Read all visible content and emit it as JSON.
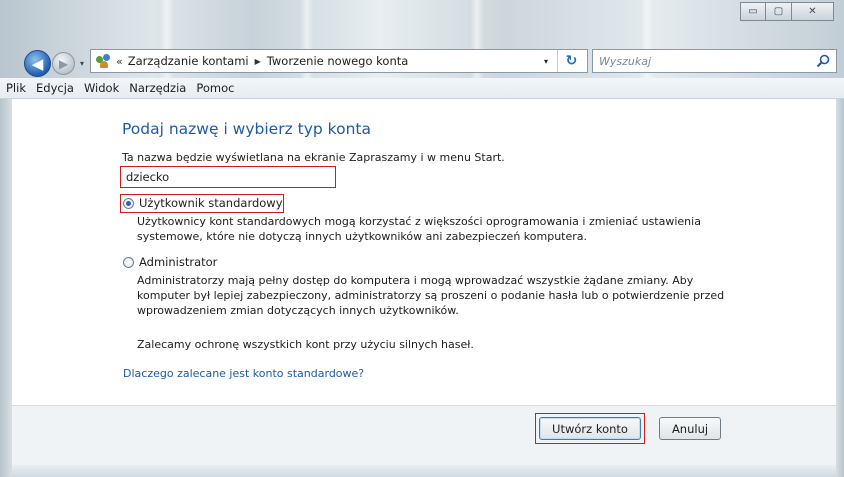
{
  "window": {
    "caption_buttons": {
      "minimize": "▭",
      "maximize": "▢",
      "close": "✕"
    }
  },
  "address_bar": {
    "chevrons": "«",
    "crumbs": [
      "Zarządzanie kontami",
      "Tworzenie nowego konta"
    ],
    "separator": "▶",
    "dropdown_glyph": "▾",
    "refresh_glyph": "↻",
    "icon": "users-icon"
  },
  "search": {
    "placeholder": "Wyszukaj",
    "icon": "search-icon"
  },
  "nav": {
    "back_glyph": "◀",
    "forward_glyph": "▶",
    "dropdown_glyph": "▾"
  },
  "menu": {
    "items": [
      "Plik",
      "Edycja",
      "Widok",
      "Narzędzia",
      "Pomoc"
    ]
  },
  "form": {
    "heading": "Podaj nazwę i wybierz typ konta",
    "name_hint": "Ta nazwa będzie wyświetlana na ekranie Zapraszamy i w menu Start.",
    "name_value": "dziecko",
    "options": [
      {
        "label": "Użytkownik standardowy",
        "checked": true,
        "description": "Użytkownicy kont standardowych mogą korzystać z większości oprogramowania i zmieniać ustawienia systemowe, które nie dotyczą innych użytkowników ani zabezpieczeń komputera."
      },
      {
        "label": "Administrator",
        "checked": false,
        "description": "Administratorzy mają pełny dostęp do komputera i mogą wprowadzać wszystkie żądane zmiany. Aby komputer był lepiej zabezpieczony, administratorzy są proszeni o podanie hasła lub o potwierdzenie przed wprowadzeniem zmian dotyczących innych użytkowników."
      }
    ],
    "recommendation": "Zalecamy ochronę wszystkich kont przy użyciu silnych haseł.",
    "why_link": "Dlaczego zalecane jest konto standardowe?"
  },
  "footer": {
    "create_label": "Utwórz konto",
    "cancel_label": "Anuluj"
  },
  "colors": {
    "heading": "#1e5aa8",
    "highlight_frame": "#d11b1b",
    "link": "#1e5aa8"
  }
}
